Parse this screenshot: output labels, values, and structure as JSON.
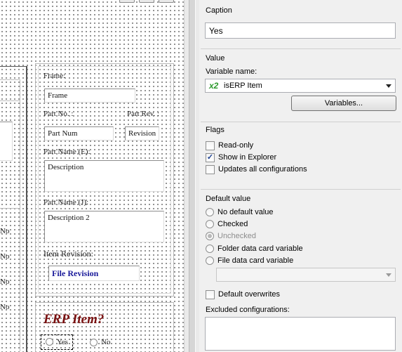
{
  "designer": {
    "labels": {
      "frame": "Frame:",
      "part_no": "Part No. :",
      "part_rev": "Part Rev. :",
      "part_name_e": "Part Name (E):",
      "part_name_j": "Part Name (J):",
      "item_revision": "Item Revision:"
    },
    "fields": {
      "frame": "Frame",
      "part_num": "Part Num",
      "revision": "Revision",
      "description": "Description",
      "description2": "Description 2",
      "file_revision": "File Revision"
    },
    "left_no_labels": [
      "No",
      "No",
      "No",
      "No"
    ],
    "erp": {
      "title": "ERP Item?",
      "yes": "Yes",
      "no": "No"
    }
  },
  "panel": {
    "caption": {
      "title": "Caption",
      "value": "Yes"
    },
    "value": {
      "title": "Value",
      "variable_label": "Variable name:",
      "variable_icon": "x2",
      "variable_value": "isERP Item",
      "variables_button": "Variables..."
    },
    "flags": {
      "title": "Flags",
      "items": [
        {
          "label": "Read-only",
          "checked": false
        },
        {
          "label": "Show in Explorer",
          "checked": true
        },
        {
          "label": "Updates all configurations",
          "checked": false
        }
      ]
    },
    "default_value": {
      "title": "Default value",
      "options": [
        {
          "label": "No default value",
          "selected": false,
          "disabled": false
        },
        {
          "label": "Checked",
          "selected": false,
          "disabled": false
        },
        {
          "label": "Unchecked",
          "selected": true,
          "disabled": true
        },
        {
          "label": "Folder data card variable",
          "selected": false,
          "disabled": false
        },
        {
          "label": "File data card variable",
          "selected": false,
          "disabled": false
        }
      ],
      "overwrite_label": "Default overwrites",
      "excluded_label": "Excluded configurations:"
    }
  },
  "colors": {
    "erp_title": "#7a1010",
    "file_revision": "#1a1a9a",
    "variable_icon": "#2e9a2e"
  }
}
